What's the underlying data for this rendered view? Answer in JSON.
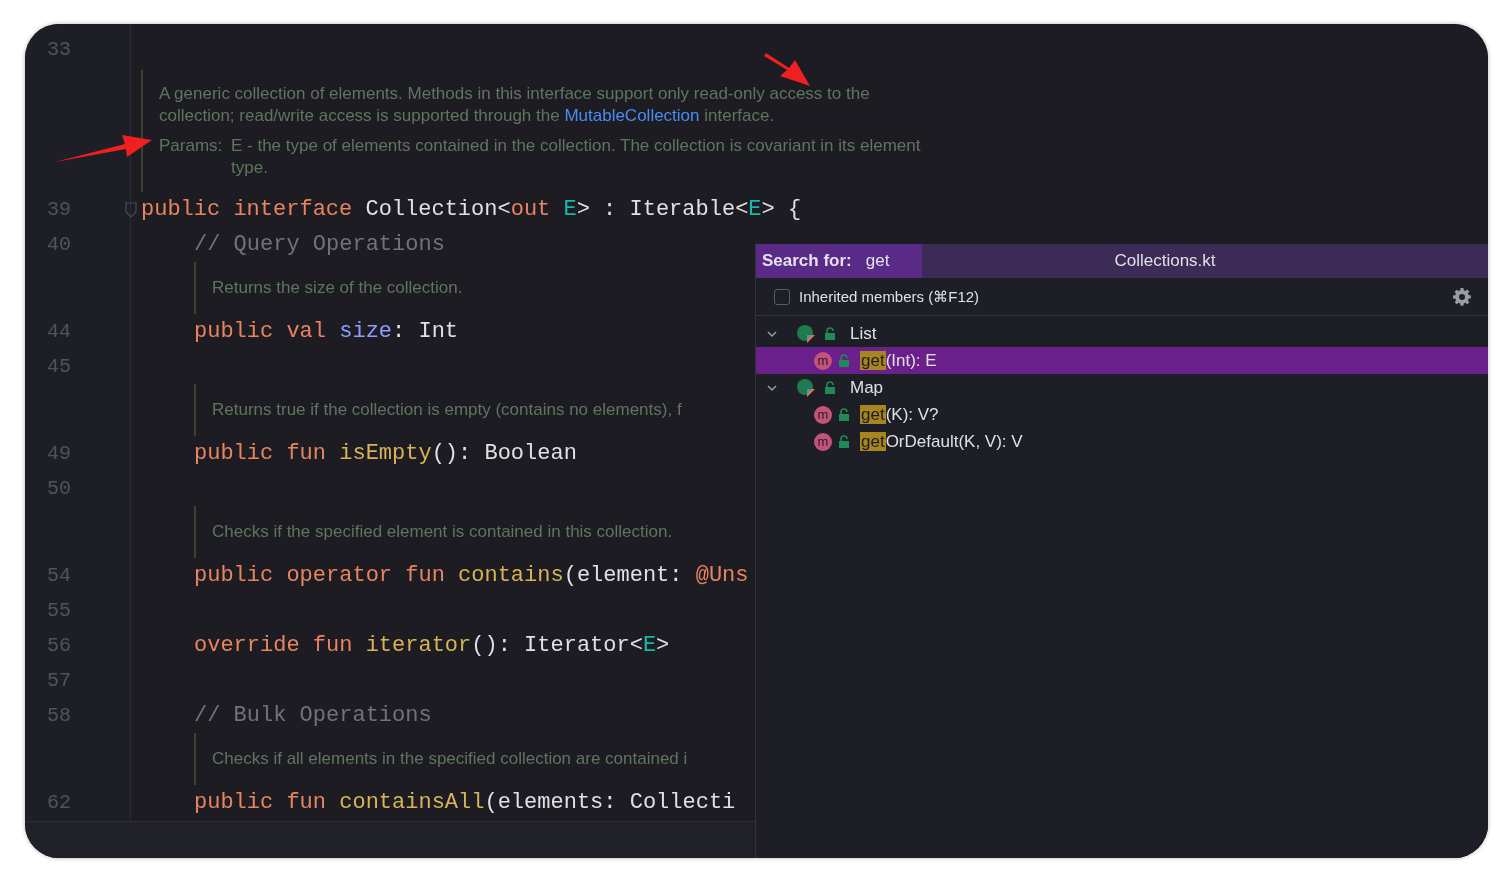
{
  "editor": {
    "rows": [
      {
        "kind": "code",
        "number": "33"
      },
      {
        "kind": "doc",
        "paragraph": {
          "before": "A generic collection of elements. Methods in this interface support only read-only access to the collection; read/write access is supported through the ",
          "link": "MutableCollection",
          "after": " interface."
        },
        "params_label": "Params:",
        "params_text": "E - the type of elements contained in the collection. The collection is covariant in its element type."
      },
      {
        "kind": "code",
        "number": "39",
        "fold": true,
        "tokens": [
          {
            "text": "public ",
            "kind": "kw"
          },
          {
            "text": "interface ",
            "kind": "kw"
          },
          {
            "text": "Collection<",
            "kind": "type"
          },
          {
            "text": "out ",
            "kind": "kw"
          },
          {
            "text": "E",
            "kind": "param"
          },
          {
            "text": "> : Iterable<",
            "kind": "type"
          },
          {
            "text": "E",
            "kind": "param"
          },
          {
            "text": "> {",
            "kind": "type"
          }
        ],
        "children": [
          {
            "kind": "code",
            "number": "40",
            "tokens": [
              {
                "text": "// Query Operations",
                "kind": "comment"
              }
            ]
          },
          {
            "kind": "doc",
            "text": "Returns the size of the collection."
          },
          {
            "kind": "code",
            "number": "44",
            "tokens": [
              {
                "text": "public ",
                "kind": "kw"
              },
              {
                "text": "val ",
                "kind": "kw"
              },
              {
                "text": "size",
                "kind": "prop"
              },
              {
                "text": ": Int",
                "kind": "type"
              }
            ]
          },
          {
            "kind": "code",
            "number": "45"
          },
          {
            "kind": "doc",
            "text": "Returns true if the collection is empty (contains no elements), f"
          },
          {
            "kind": "code",
            "number": "49",
            "tokens": [
              {
                "text": "public ",
                "kind": "kw"
              },
              {
                "text": "fun ",
                "kind": "kw"
              },
              {
                "text": "isEmpty",
                "kind": "fn"
              },
              {
                "text": "(): Boolean",
                "kind": "type"
              }
            ]
          },
          {
            "kind": "code",
            "number": "50"
          },
          {
            "kind": "doc",
            "text": "Checks if the specified element is contained in this collection."
          },
          {
            "kind": "code",
            "number": "54",
            "tokens": [
              {
                "text": "public ",
                "kind": "kw"
              },
              {
                "text": "operator ",
                "kind": "kw"
              },
              {
                "text": "fun ",
                "kind": "kw"
              },
              {
                "text": "contains",
                "kind": "fn"
              },
              {
                "text": "(element: ",
                "kind": "type"
              },
              {
                "text": "@Uns",
                "kind": "kw"
              }
            ]
          },
          {
            "kind": "code",
            "number": "55"
          },
          {
            "kind": "code",
            "number": "56",
            "tokens": [
              {
                "text": "override ",
                "kind": "kw"
              },
              {
                "text": "fun ",
                "kind": "kw"
              },
              {
                "text": "iterator",
                "kind": "fn"
              },
              {
                "text": "(): Iterator<",
                "kind": "type"
              },
              {
                "text": "E",
                "kind": "param"
              },
              {
                "text": ">",
                "kind": "type"
              }
            ]
          },
          {
            "kind": "code",
            "number": "57"
          },
          {
            "kind": "code",
            "number": "58",
            "tokens": [
              {
                "text": "// Bulk Operations",
                "kind": "comment"
              }
            ]
          },
          {
            "kind": "doc",
            "text": "Checks if all elements in the specified collection are contained i"
          },
          {
            "kind": "code",
            "number": "62",
            "tokens": [
              {
                "text": "public ",
                "kind": "kw"
              },
              {
                "text": "fun ",
                "kind": "kw"
              },
              {
                "text": "containsAll",
                "kind": "fn"
              },
              {
                "text": "(elements: Collecti",
                "kind": "type"
              }
            ]
          }
        ]
      }
    ]
  },
  "popup": {
    "search_label": "Search for:",
    "search_value": "get",
    "file_title": "Collections.kt",
    "inherited": {
      "label": "Inherited members (⌘F12)",
      "checked": false
    },
    "tree": [
      {
        "label": "List",
        "expanded": true,
        "children": [
          {
            "badge": "m",
            "match": "get",
            "rest": "(Int): E",
            "selected": true
          }
        ]
      },
      {
        "label": "Map",
        "expanded": true,
        "children": [
          {
            "badge": "m",
            "match": "get",
            "rest": "(K): V?",
            "selected": false
          },
          {
            "badge": "m",
            "match": "get",
            "rest": "OrDefault(K, V): V",
            "selected": false
          }
        ]
      }
    ]
  }
}
